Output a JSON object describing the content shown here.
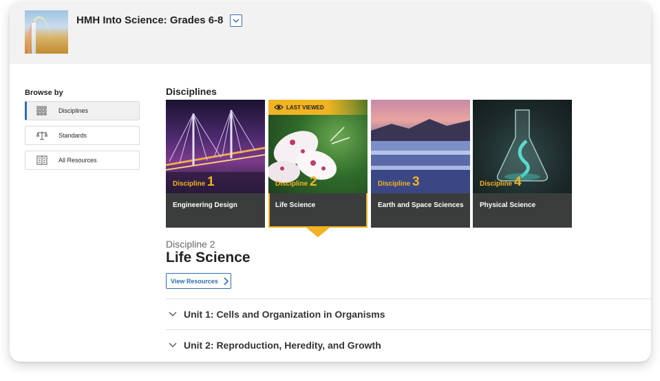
{
  "header": {
    "product_title": "HMH Into Science: Grades 6-8",
    "cover_icon": "product-cover-image",
    "dropdown_icon": "chevron-down-icon"
  },
  "sidebar": {
    "browse_label": "Browse by",
    "items": [
      {
        "label": "Disciplines",
        "icon": "grid-icon",
        "active": true
      },
      {
        "label": "Standards",
        "icon": "scale-icon",
        "active": false
      },
      {
        "label": "All Resources",
        "icon": "book-icon",
        "active": false
      }
    ]
  },
  "main": {
    "section_title": "Disciplines",
    "cards": [
      {
        "disc_label": "Discipline",
        "disc_number": "1",
        "name": "Engineering Design"
      },
      {
        "disc_label": "Discipline",
        "disc_number": "2",
        "name": "Life Science",
        "badge": "LAST VIEWED",
        "selected": true
      },
      {
        "disc_label": "Discipline",
        "disc_number": "3",
        "name": "Earth and Space Sciences"
      },
      {
        "disc_label": "Discipline",
        "disc_number": "4",
        "name": "Physical Science"
      }
    ],
    "selected": {
      "subtitle": "Discipline 2",
      "title": "Life Science",
      "view_button": "View Resources"
    },
    "units": [
      {
        "label": "Unit 1: Cells and Organization in Organisms"
      },
      {
        "label": "Unit 2: Reproduction, Heredity, and Growth"
      }
    ]
  },
  "colors": {
    "accent": "#f0b323",
    "link": "#2b6cb0",
    "card_bg": "#3b3d3d"
  }
}
